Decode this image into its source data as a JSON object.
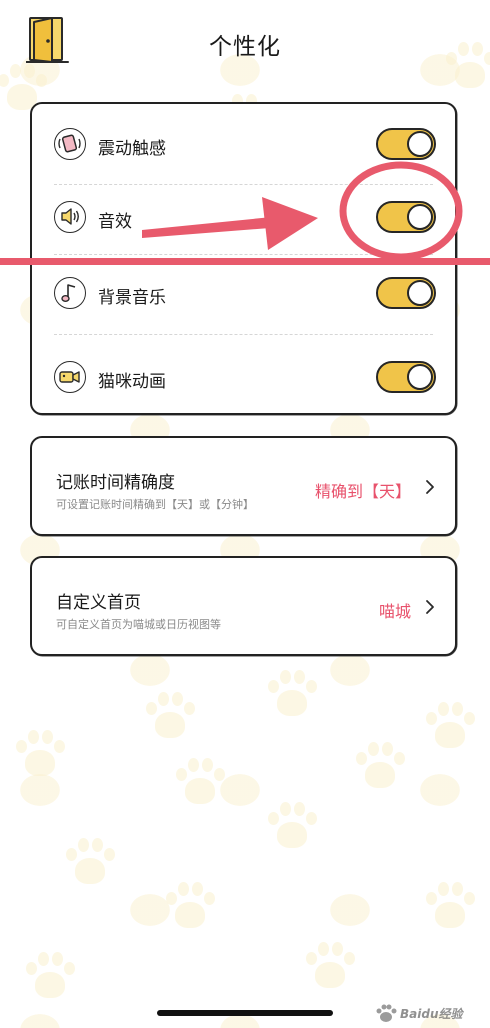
{
  "header": {
    "title": "个性化",
    "back_icon": "door-icon"
  },
  "toggles": [
    {
      "label": "震动触感",
      "icon": "vibration-icon",
      "on": true
    },
    {
      "label": "音效",
      "icon": "speaker-icon",
      "on": true
    },
    {
      "label": "背景音乐",
      "icon": "music-note-icon",
      "on": true
    },
    {
      "label": "猫咪动画",
      "icon": "video-camera-icon",
      "on": true
    }
  ],
  "precision": {
    "title": "记账时间精确度",
    "subtitle": "可设置记账时间精确到【天】或【分钟】",
    "value": "精确到【天】"
  },
  "home": {
    "title": "自定义首页",
    "subtitle": "可自定义首页为喵城或日历视图等",
    "value": "喵城"
  },
  "watermark": "Baidu经验",
  "colors": {
    "toggle_on": "#f0c449",
    "accent_value": "#e8526c",
    "annotation": "#e85a6c",
    "paw": "#faf0cd"
  }
}
